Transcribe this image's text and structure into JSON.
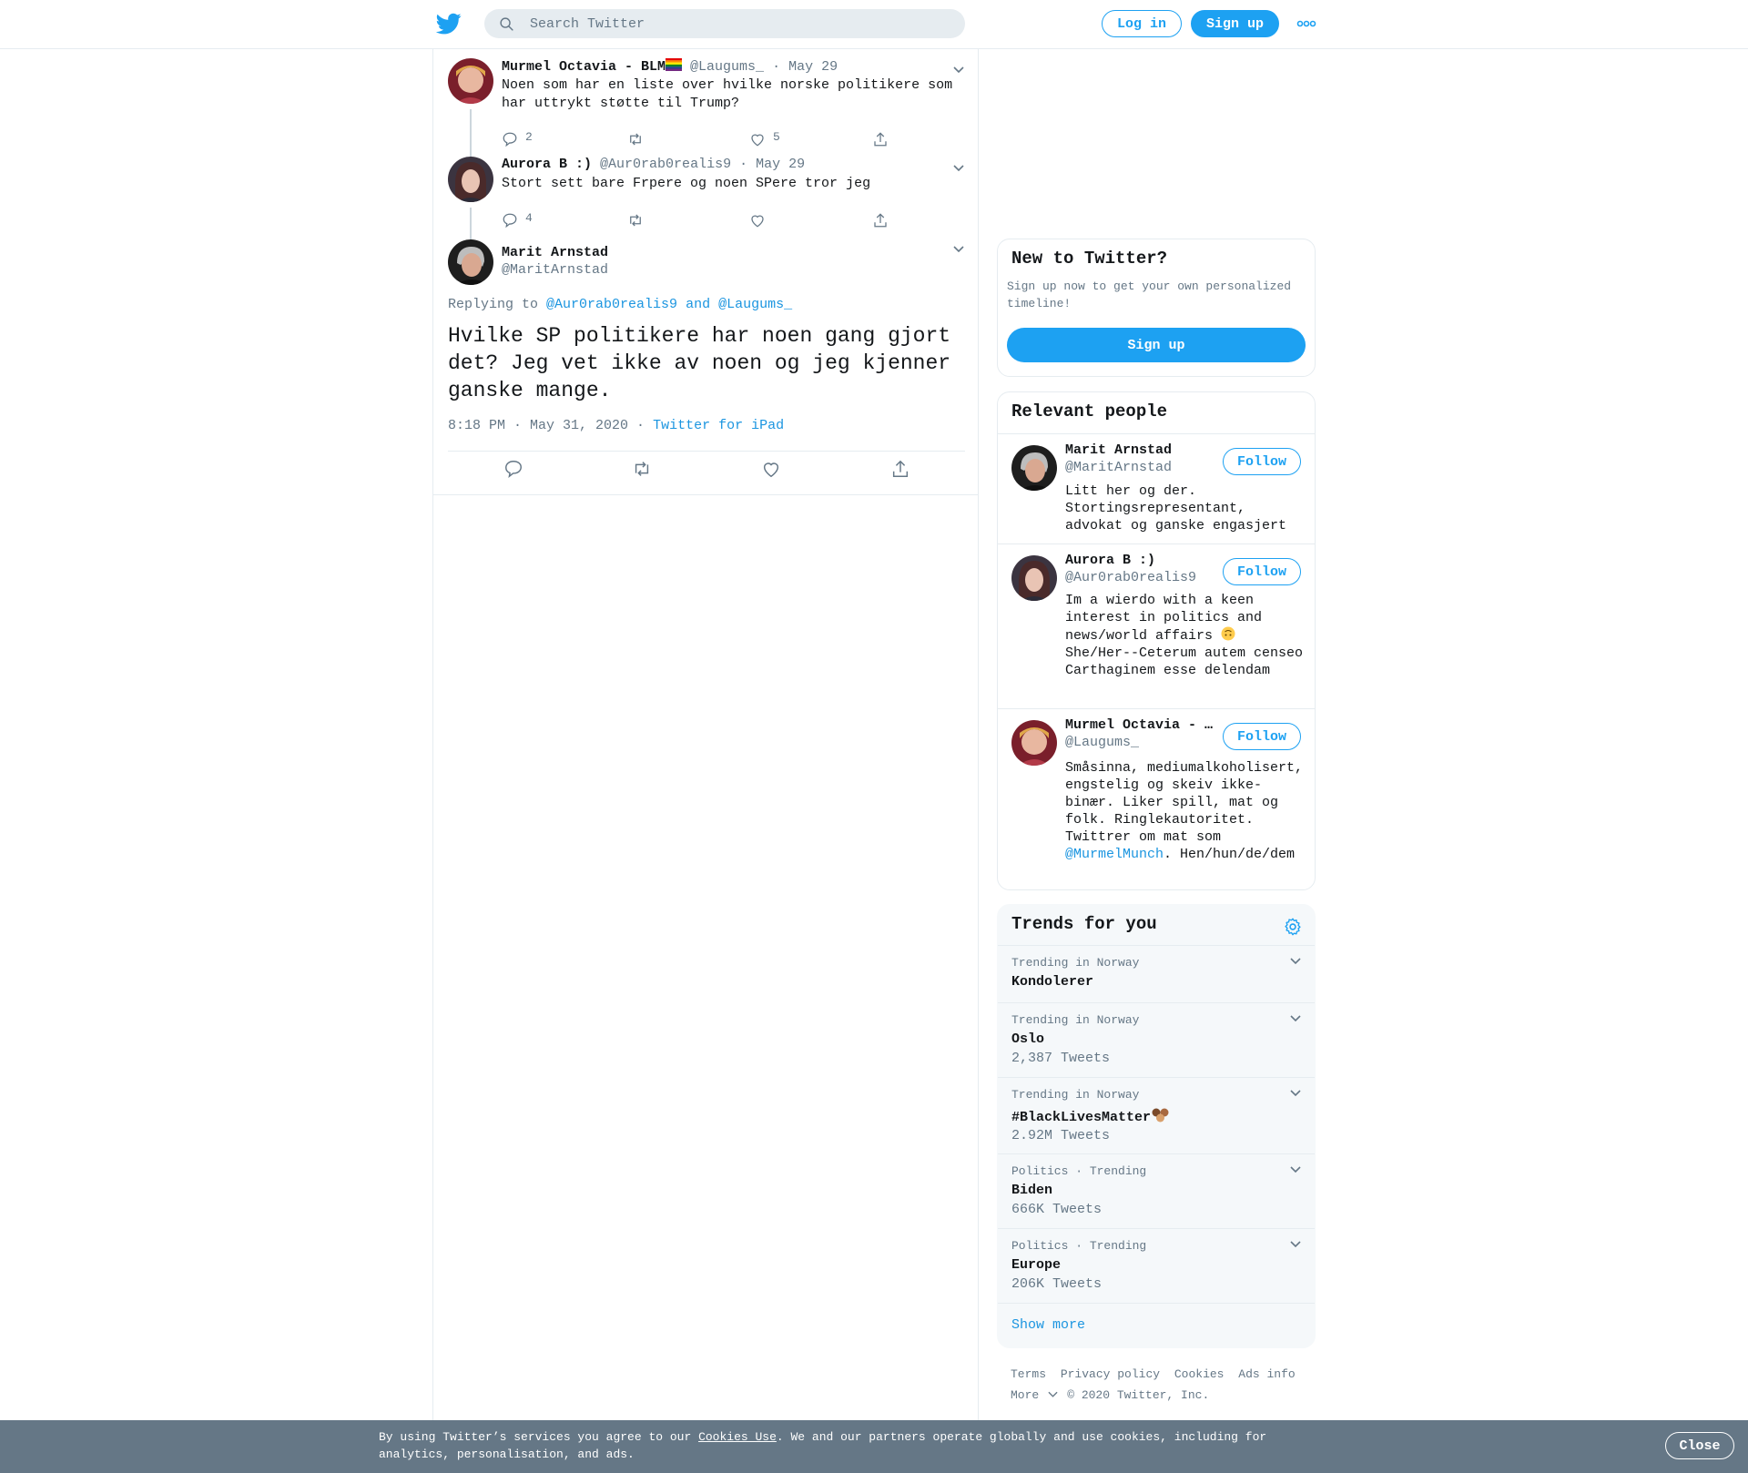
{
  "header": {
    "search_placeholder": "Search Twitter",
    "login_label": "Log in",
    "signup_label": "Sign up"
  },
  "thread": [
    {
      "name": "Murmel Octavia - BLM",
      "handle": "@Laugums_",
      "date": "May 29",
      "text": "Noen som har en liste over hvilke norske politikere som har uttrykt støtte til Trump?",
      "replies": "2",
      "retweets": "",
      "likes": "5"
    },
    {
      "name": "Aurora B :)",
      "handle": "@Aur0rab0realis9",
      "date": "May 29",
      "text": "Stort sett bare Frpere og noen SPere tror jeg",
      "replies": "4",
      "retweets": "",
      "likes": ""
    }
  ],
  "focused": {
    "name": "Marit Arnstad",
    "handle": "@MaritArnstad",
    "replying_prefix": "Replying to ",
    "replying_to_1": "@Aur0rab0realis9",
    "replying_and": " and ",
    "replying_to_2": "@Laugums_",
    "text": "Hvilke SP politikere har noen gang gjort det? Jeg vet ikke av noen og jeg kjenner ganske mange.",
    "time": "8:18 PM · May 31, 2020",
    "separator": " · ",
    "source": "Twitter for iPad"
  },
  "new_to_twitter": {
    "title": "New to Twitter?",
    "subtitle": "Sign up now to get your own personalized timeline!",
    "button": "Sign up"
  },
  "relevant_people": {
    "title": "Relevant people",
    "people": [
      {
        "name": "Marit Arnstad",
        "handle": "@MaritArnstad",
        "bio": "Litt her og der. Stortingsrepresentant, advokat og ganske engasjert",
        "follow": "Follow"
      },
      {
        "name": "Aurora B :)",
        "handle": "@Aur0rab0realis9",
        "bio_1": "Im a wierdo with a keen interest in politics and news/world affairs",
        "bio_2": "She/Her--Ceterum autem censeo Carthaginem esse delendam",
        "follow": "Follow"
      },
      {
        "name": "Murmel Octavia - …",
        "handle": "@Laugums_",
        "bio_1": "Småsinna, mediumalkoholisert, engstelig og skeiv ikke-binær. Liker spill, mat og folk. Ringlekautoritet. Twittrer om mat som ",
        "bio_link": "@MurmelMunch",
        "bio_2": ". Hen/hun/de/dem",
        "follow": "Follow"
      }
    ]
  },
  "trends": {
    "title": "Trends for you",
    "items": [
      {
        "meta": "Trending in Norway",
        "name": "Kondolerer",
        "count": ""
      },
      {
        "meta": "Trending in Norway",
        "name": "Oslo",
        "count": "2,387 Tweets"
      },
      {
        "meta": "Trending in Norway",
        "name": "#BlackLivesMatter",
        "count": "2.92M Tweets"
      },
      {
        "meta": "Politics · Trending",
        "name": "Biden",
        "count": "666K Tweets"
      },
      {
        "meta": "Politics · Trending",
        "name": "Europe",
        "count": "206K Tweets"
      }
    ],
    "show_more": "Show more"
  },
  "footer": {
    "terms": "Terms",
    "privacy": "Privacy policy",
    "cookies": "Cookies",
    "ads": "Ads info",
    "more": "More",
    "copyright": "© 2020 Twitter, Inc."
  },
  "cookie_bar": {
    "text_1": "By using Twitter’s services you agree to our ",
    "link": "Cookies Use",
    "text_2": ". We and our partners operate globally and use cookies, including for analytics, personalisation, and ads.",
    "close": "Close"
  },
  "colors": {
    "accent": "#1da1f2",
    "link": "#1b95e0",
    "secondary_text": "#657786",
    "border": "#e6ecf0",
    "cookie_bg": "#657786"
  },
  "icons": [
    "twitter-bird-icon",
    "search-icon",
    "more-dots-icon",
    "chevron-down-icon",
    "reply-icon",
    "retweet-icon",
    "like-icon",
    "share-icon",
    "gear-icon",
    "rainbow-flag-emoji",
    "upside-down-face-emoji",
    "raised-fists-emoji"
  ]
}
